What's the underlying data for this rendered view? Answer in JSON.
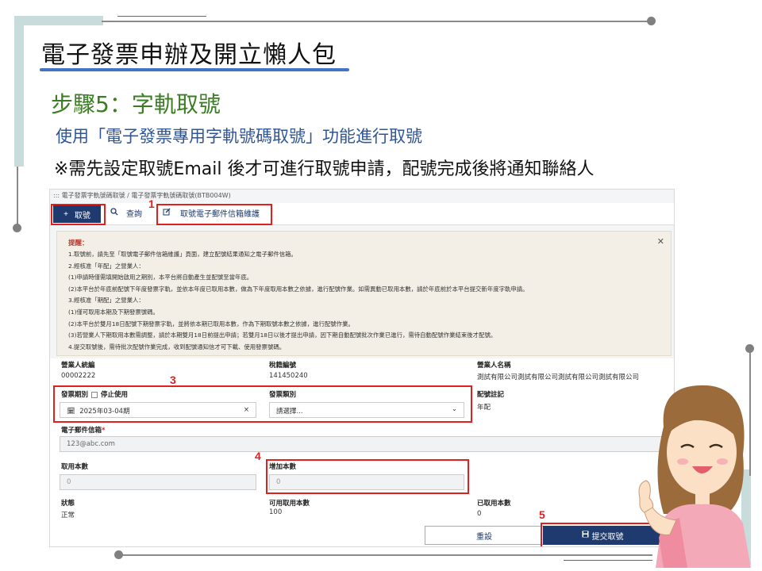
{
  "slide": {
    "title": "電子發票申辦及開立懶人包",
    "step_title": "步驟5：字軌取號",
    "step_desc": "使用「電子發票專用字軌號碼取號」功能進行取號",
    "step_note": "※需先設定取號Email 後才可進行取號申請，配號完成後將通知聯絡人"
  },
  "markers": [
    "1",
    "3",
    "4",
    "5"
  ],
  "app": {
    "breadcrumb": "::: 電子發票字軌號碼取號 / 電子發票字軌號碼取號(BTB004W)",
    "toolbar": {
      "get_number": "取號",
      "query": "查詢",
      "maintain_email": "取號電子郵件信箱維護"
    },
    "notice": {
      "heading": "提醒：",
      "lines": [
        "1.取號前，請先至「取號電子郵件信箱維護」頁面，建立配號結果通知之電子郵件信箱。",
        "2.經核准「年配」之營業人：",
        "(1)申請時僅需填開始啟用之期別，本平台將自動產生並配號至當年底。",
        "(2)本平台於年底前配號下年度發票字軌，並依本年度已取用本數，做為下年度取用本數之依據，進行配號作業。如需異動已取用本數，請於年底前於本平台提交新年度字軌申請。",
        "3.經核准「期配」之營業人：",
        "(1)僅可取用本期及下期發票號碼。",
        "(2)本平台於雙月18日配號下期發票字軌，並將依本期已取用本數，作為下期取號本數之依據，進行配號作業。",
        "(3)若營業人下期取用本數需調整，請於本期雙月18日前提出申請；若雙月18日以後才提出申請，因下期自動配號批次作業已進行，需待自動配號作業結束後才配號。",
        "4.提交取號後，需待批次配號作業完成，收到配號通知信才可下載、使用發票號碼。"
      ]
    },
    "form": {
      "taxpayer_id_label": "營業人統編",
      "taxpayer_id": "00002222",
      "tax_reg_label": "稅籍編號",
      "tax_reg": "141450240",
      "name_label": "營業人名稱",
      "name": "測試有限公司測試有限公司測試有限公司測試有限公司",
      "period_label": "發票期別",
      "stop_label": "停止使用",
      "period_value": "2025年03-04期",
      "type_label": "發票類別",
      "type_placeholder": "請選擇...",
      "note_label": "配號註記",
      "note_value": "年配",
      "email_label": "電子郵件信箱",
      "email_required": "*",
      "email_value": "123@abc.com",
      "used_label": "取用本數",
      "used_value": "0",
      "add_label": "增加本數",
      "add_value": "0",
      "status_label": "狀態",
      "status_value": "正常",
      "available_label": "可用取用本數",
      "available_value": "100",
      "taken_label": "已取用本數",
      "taken_value": "0",
      "reset_button": "重設",
      "submit_button": "提交取號"
    }
  },
  "colors": {
    "accent_navy": "#1f3a6e",
    "highlight_red": "#e01f1f",
    "step_green": "#3a7d22",
    "desc_blue": "#2f5597"
  }
}
